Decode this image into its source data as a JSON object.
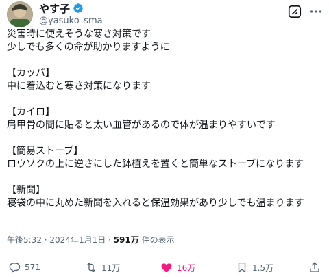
{
  "header": {
    "display_name": "やす子",
    "handle": "@yasuko_sma"
  },
  "tweet": {
    "lines": [
      [
        "災害時に使えそうな寒さ対策です",
        "少しでも多くの命が助かりますように"
      ],
      [
        "【カッパ】",
        "中に着込むと寒さ対策になります"
      ],
      [
        "【カイロ】",
        "肩甲骨の間に貼ると太い血管があるので体が温まりやすいです"
      ],
      [
        "【簡易ストーブ】",
        "ロウソクの上に逆さにした鉢植えを置くと簡単なストーブになります"
      ],
      [
        "【新聞】",
        "寝袋の中に丸めた新聞を入れると保温効果があり少しでも温まります"
      ]
    ]
  },
  "meta": {
    "time": "午後5:32",
    "date": "2024年1月1日",
    "views": "591万",
    "views_label": "件の表示"
  },
  "actions": {
    "reply_count": "571",
    "repost_count": "11万",
    "like_count": "16万",
    "view_count": "1.5万"
  },
  "colors": {
    "text": "#0f1419",
    "secondary": "#536471",
    "verified": "#1d9bf0",
    "like": "#f91880"
  }
}
